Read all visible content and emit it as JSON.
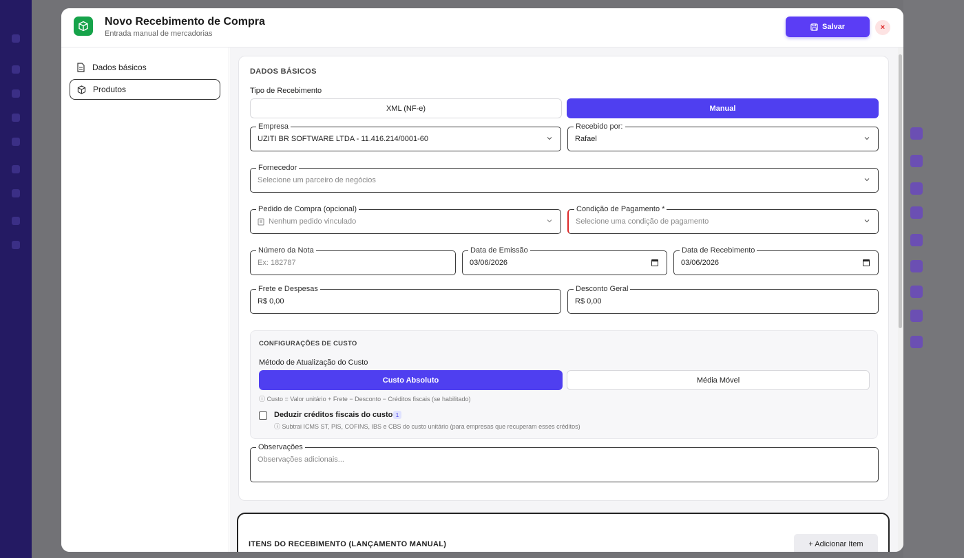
{
  "modal": {
    "title": "Novo Recebimento de Compra",
    "subtitle": "Entrada manual de mercadorias",
    "save_label": "Salvar",
    "close_label": "×",
    "accent_color": "#5b3df5",
    "logo_color": "#16a34a"
  },
  "sidebar": {
    "items": [
      {
        "label": "Dados básicos",
        "icon": "document-icon"
      },
      {
        "label": "Produtos",
        "icon": "box-icon"
      }
    ]
  },
  "basics": {
    "section_title": "DADOS BÁSICOS",
    "tipo_label": "Tipo de Recebimento",
    "tipo_options": [
      "XML (NF-e)",
      "Manual"
    ],
    "tipo_selected": "Manual",
    "empresa": {
      "label": "Empresa",
      "value": "UZITI BR SOFTWARE LTDA - 11.416.214/0001-60"
    },
    "recebido_por": {
      "label": "Recebido por:",
      "value": "Rafael"
    },
    "fornecedor": {
      "label": "Fornecedor",
      "placeholder": "Selecione um parceiro de negócios"
    },
    "pedido": {
      "label": "Pedido de Compra (opcional)",
      "placeholder": "Nenhum pedido vinculado"
    },
    "condicao": {
      "label": "Condição de Pagamento *",
      "placeholder": "Selecione uma condição de pagamento"
    },
    "numero_nota": {
      "label": "Número da Nota",
      "placeholder": "Ex: 182787"
    },
    "data_emissao": {
      "label": "Data de Emissão",
      "value": "03/06/2026"
    },
    "data_recebimento": {
      "label": "Data de Recebimento",
      "value": "03/06/2026"
    },
    "frete": {
      "label": "Frete e Despesas",
      "value": "R$ 0,00"
    },
    "desconto": {
      "label": "Desconto Geral",
      "value": "R$ 0,00"
    }
  },
  "custo": {
    "section_title": "CONFIGURAÇÕES DE CUSTO",
    "metodo_label": "Método de Atualização do Custo",
    "options": [
      "Custo Absoluto",
      "Média Móvel"
    ],
    "selected": "Custo Absoluto",
    "formula_hint": "ⓘ Custo = Valor unitário + Frete − Desconto − Créditos fiscais (se habilitado)",
    "deduzir_label": "Deduzir créditos fiscais do custo",
    "deduzir_badge": "1",
    "deduzir_checked": false,
    "deduzir_hint": "ⓘ Subtrai ICMS ST, PIS, COFINS, IBS e CBS do custo unitário (para empresas que recuperam esses créditos)"
  },
  "observacoes": {
    "label": "Observações",
    "placeholder": "Observações adicionais..."
  },
  "items_section": {
    "title": "ITENS DO RECEBIMENTO (LANÇAMENTO MANUAL)",
    "add_label": "+ Adicionar Item"
  }
}
